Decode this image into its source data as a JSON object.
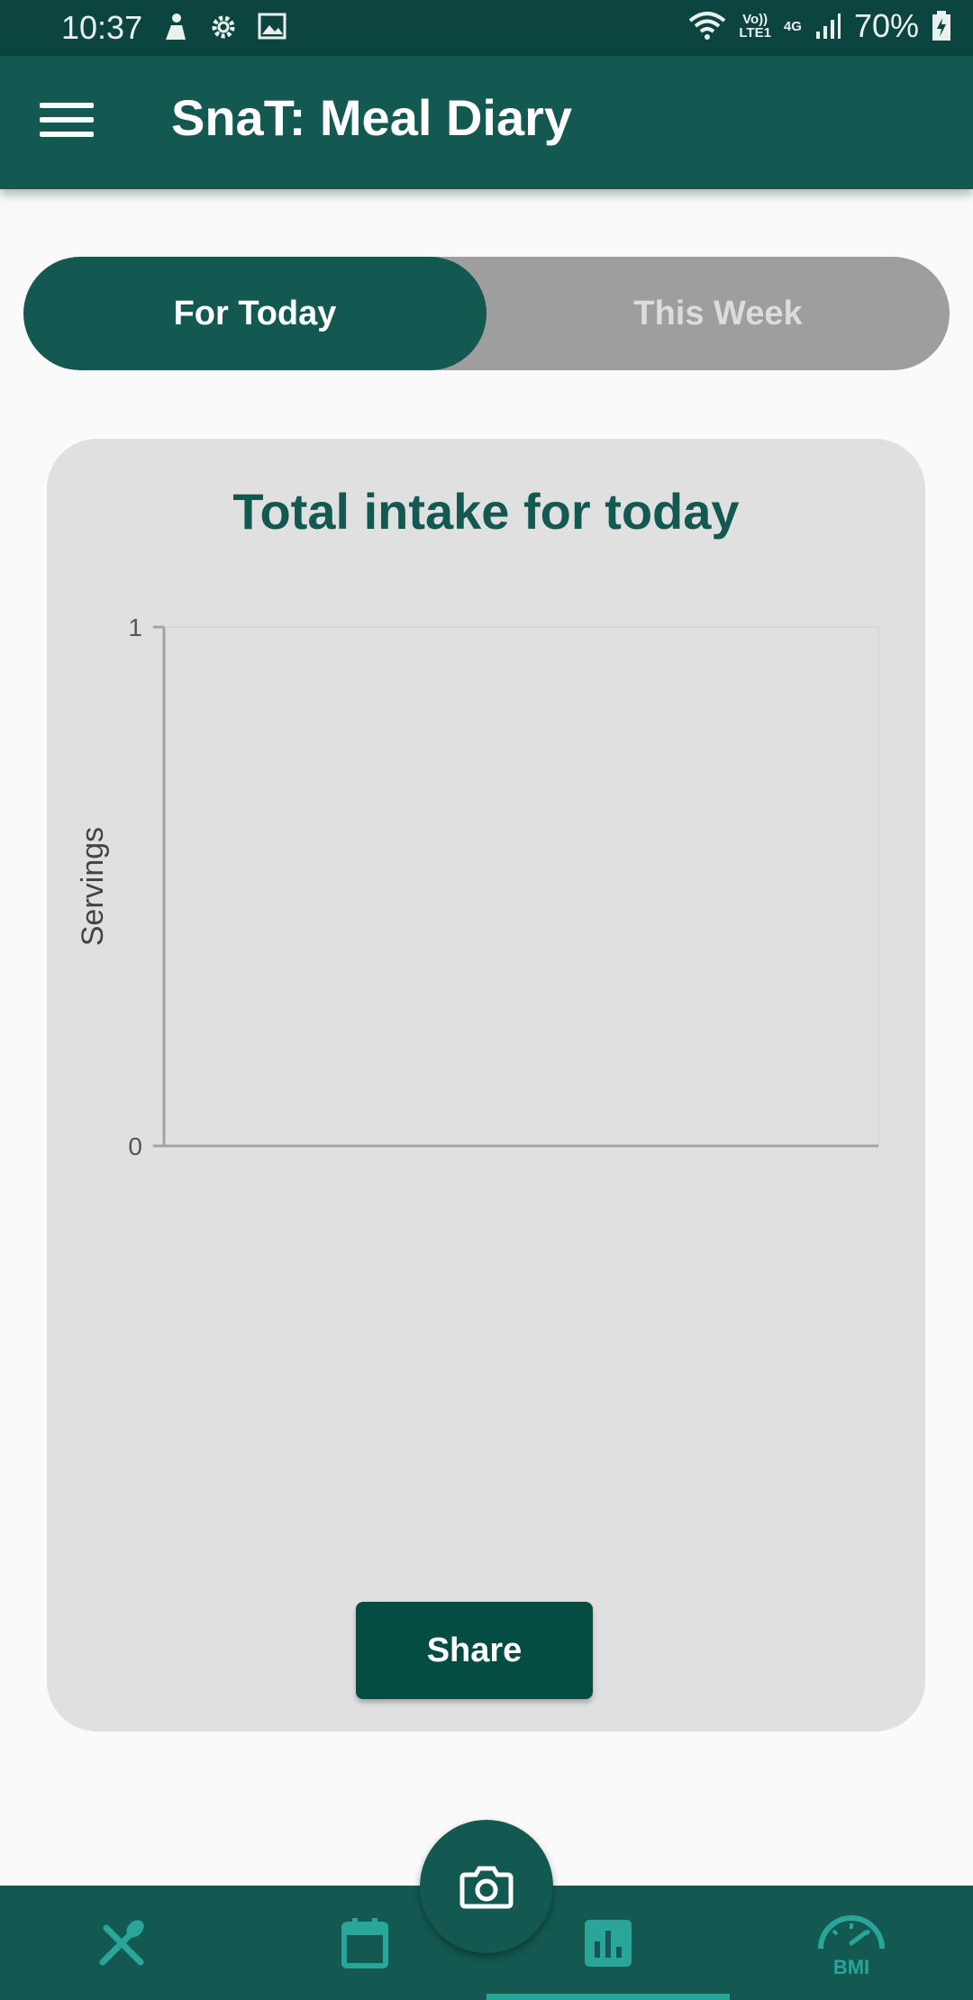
{
  "status_bar": {
    "time": "10:37",
    "network_top": "Vo))",
    "network_bottom": "LTE1",
    "network_type": "4G",
    "battery": "70%"
  },
  "app_bar": {
    "title": "SnaT: Meal Diary",
    "menu_icon": "hamburger-menu-icon"
  },
  "toggle": {
    "today_label": "For Today",
    "week_label": "This Week",
    "selected": "For Today"
  },
  "chart": {
    "title": "Total intake for today",
    "share_label": "Share"
  },
  "chart_data": {
    "type": "bar",
    "title": "Total intake for today",
    "xlabel": "",
    "ylabel": "Servings",
    "ylim": [
      0,
      1
    ],
    "y_ticks": [
      "1",
      "0"
    ],
    "categories": [],
    "values": []
  },
  "bottom_nav": {
    "items": [
      {
        "icon": "fork-knife-icon"
      },
      {
        "icon": "calendar-icon"
      },
      {
        "icon": "bar-chart-icon",
        "active": true
      },
      {
        "icon": "bmi-gauge-icon",
        "text": "BMI"
      }
    ],
    "fab_icon": "camera-icon"
  },
  "colors": {
    "primary": "#135951",
    "status_bar": "#0c4540",
    "accent": "#2aa59a",
    "card": "#e0e0e0",
    "toggle_inactive": "#9e9e9e"
  }
}
